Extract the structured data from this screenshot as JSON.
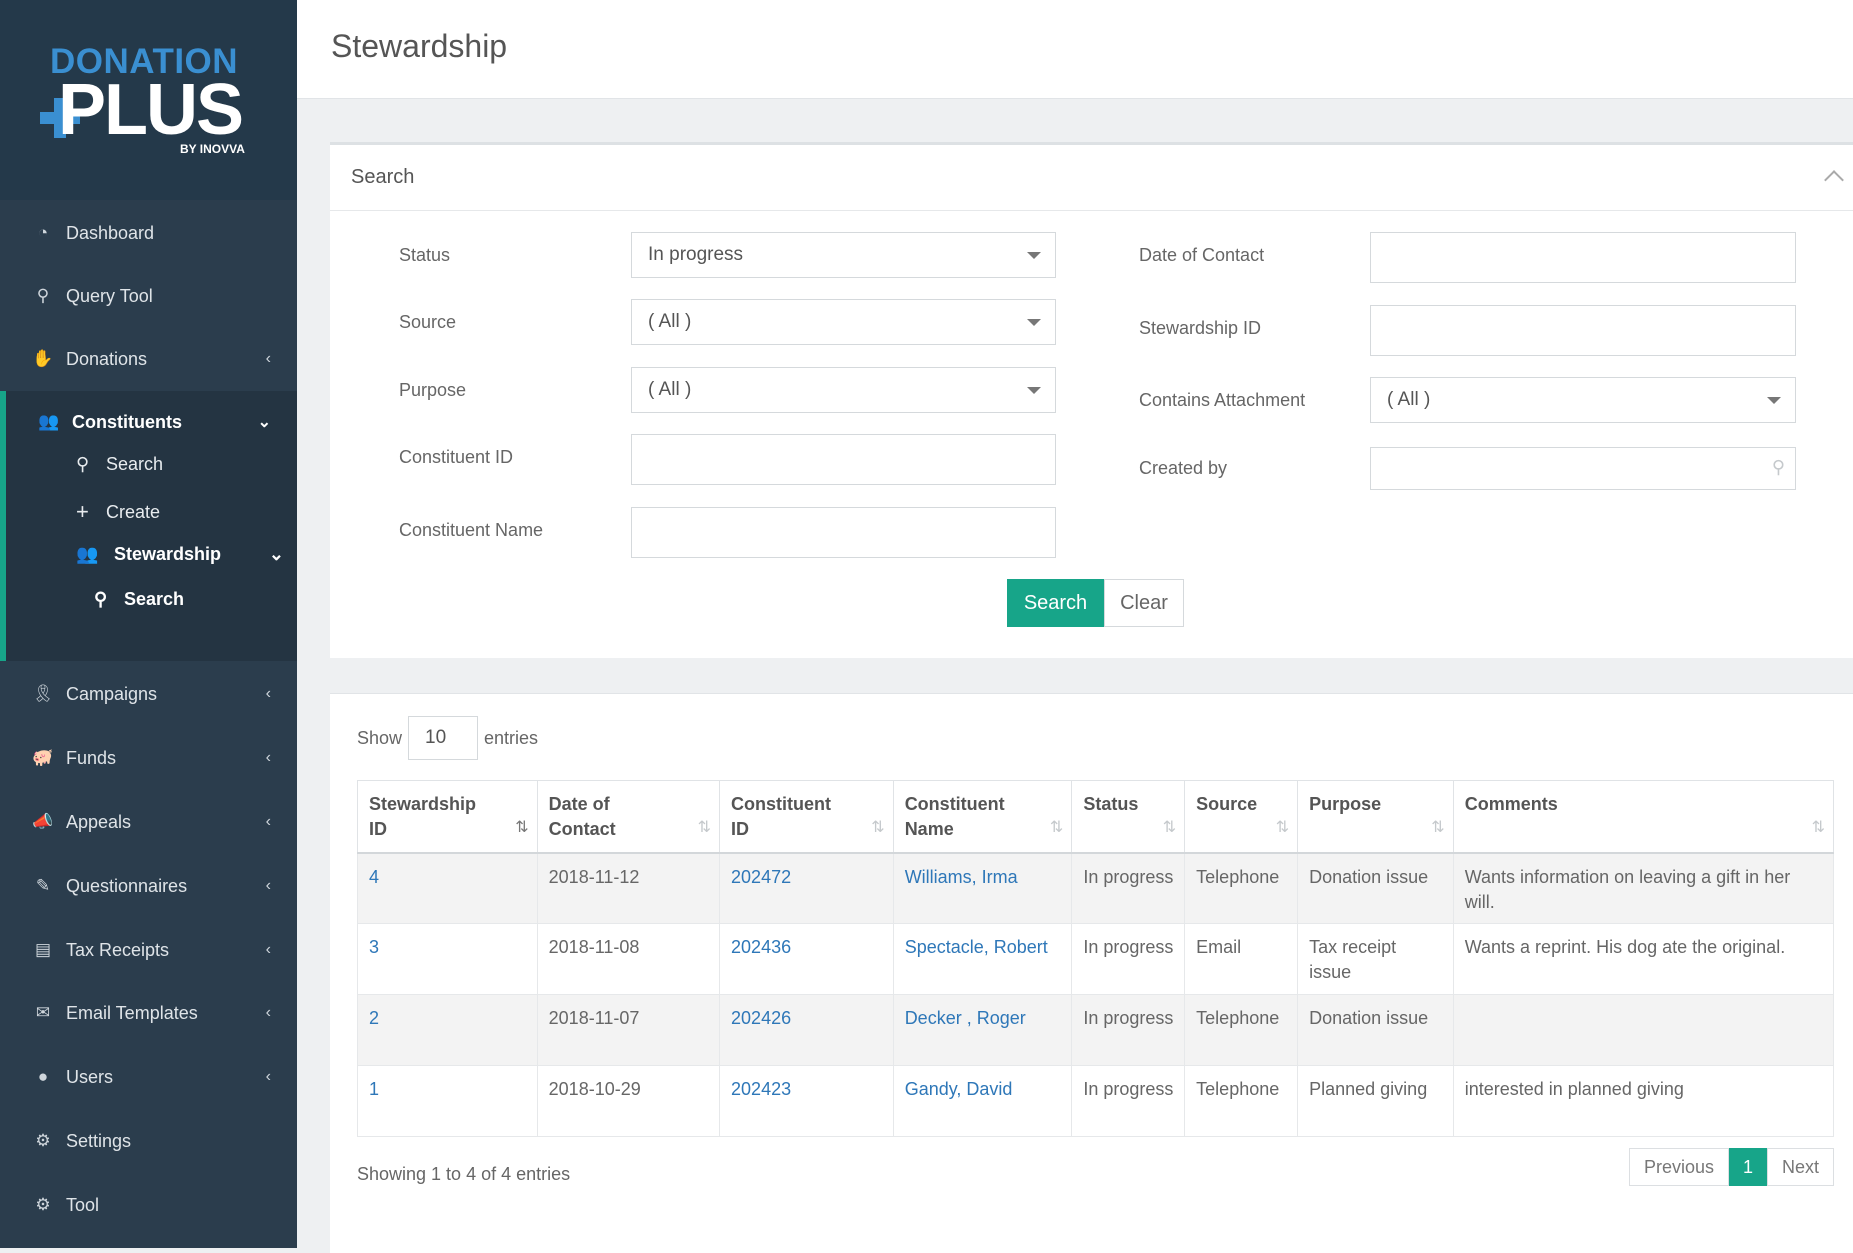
{
  "app": {
    "logo_top": "DONATION",
    "logo_main": "PLUS",
    "logo_by": "BY INOVVA"
  },
  "sidebar": {
    "items": [
      {
        "label": "Dashboard",
        "icon": "dashboard-icon"
      },
      {
        "label": "Query Tool",
        "icon": "search-icon"
      },
      {
        "label": "Donations",
        "icon": "hand-donate-icon"
      },
      {
        "label": "Constituents",
        "icon": "users-icon"
      },
      {
        "label": "Campaigns",
        "icon": "ribbon-icon"
      },
      {
        "label": "Funds",
        "icon": "piggy-bank-icon"
      },
      {
        "label": "Appeals",
        "icon": "megaphone-icon"
      },
      {
        "label": "Questionnaires",
        "icon": "edit-icon"
      },
      {
        "label": "Tax Receipts",
        "icon": "receipt-icon"
      },
      {
        "label": "Email Templates",
        "icon": "envelope-open-icon"
      },
      {
        "label": "Users",
        "icon": "user-icon"
      },
      {
        "label": "Settings",
        "icon": "gear-icon"
      },
      {
        "label": "Tool",
        "icon": "gear-icon"
      }
    ],
    "constituents_sub": {
      "search": "Search",
      "create": "Create",
      "stewardship": "Stewardship",
      "stewardship_search": "Search"
    },
    "accent": "#17a589"
  },
  "page": {
    "title": "Stewardship"
  },
  "search": {
    "header": "Search",
    "status_label": "Status",
    "status_value": "In progress",
    "source_label": "Source",
    "source_value": "( All )",
    "purpose_label": "Purpose",
    "purpose_value": "( All )",
    "constituent_id_label": "Constituent ID",
    "constituent_id_value": "",
    "constituent_name_label": "Constituent Name",
    "constituent_name_value": "",
    "date_label": "Date of Contact",
    "date_value": "",
    "stewardship_id_label": "Stewardship ID",
    "stewardship_id_value": "",
    "attachment_label": "Contains Attachment",
    "attachment_value": "( All )",
    "created_by_label": "Created by",
    "created_by_value": "",
    "search_button": "Search",
    "clear_button": "Clear"
  },
  "results": {
    "show_label": "Show",
    "page_length": "10",
    "entries_label": "entries",
    "columns": [
      {
        "line1": "Stewardship",
        "line2": "ID"
      },
      {
        "line1": "Date of",
        "line2": "Contact"
      },
      {
        "line1": "Constituent",
        "line2": "ID"
      },
      {
        "line1": "Constituent",
        "line2": "Name"
      },
      {
        "line1": "Status",
        "line2": ""
      },
      {
        "line1": "Source",
        "line2": ""
      },
      {
        "line1": "Purpose",
        "line2": ""
      },
      {
        "line1": "Comments",
        "line2": ""
      }
    ],
    "rows": [
      {
        "id": "4",
        "date": "2018-11-12",
        "cid": "202472",
        "name": "Williams, Irma",
        "status": "In progress",
        "source": "Telephone",
        "purpose": "Donation issue",
        "comments": "Wants information on leaving a gift in her will."
      },
      {
        "id": "3",
        "date": "2018-11-08",
        "cid": "202436",
        "name": "Spectacle, Robert",
        "status": "In progress",
        "source": "Email",
        "purpose": "Tax receipt issue",
        "comments": "Wants a reprint. His dog ate the original."
      },
      {
        "id": "2",
        "date": "2018-11-07",
        "cid": "202426",
        "name": "Decker , Roger",
        "status": "In progress",
        "source": "Telephone",
        "purpose": "Donation issue",
        "comments": ""
      },
      {
        "id": "1",
        "date": "2018-10-29",
        "cid": "202423",
        "name": "Gandy, David",
        "status": "In progress",
        "source": "Telephone",
        "purpose": "Planned giving",
        "comments": "interested in planned giving"
      }
    ],
    "info": "Showing 1 to 4 of 4 entries",
    "pager": {
      "previous": "Previous",
      "current": "1",
      "next": "Next"
    }
  }
}
